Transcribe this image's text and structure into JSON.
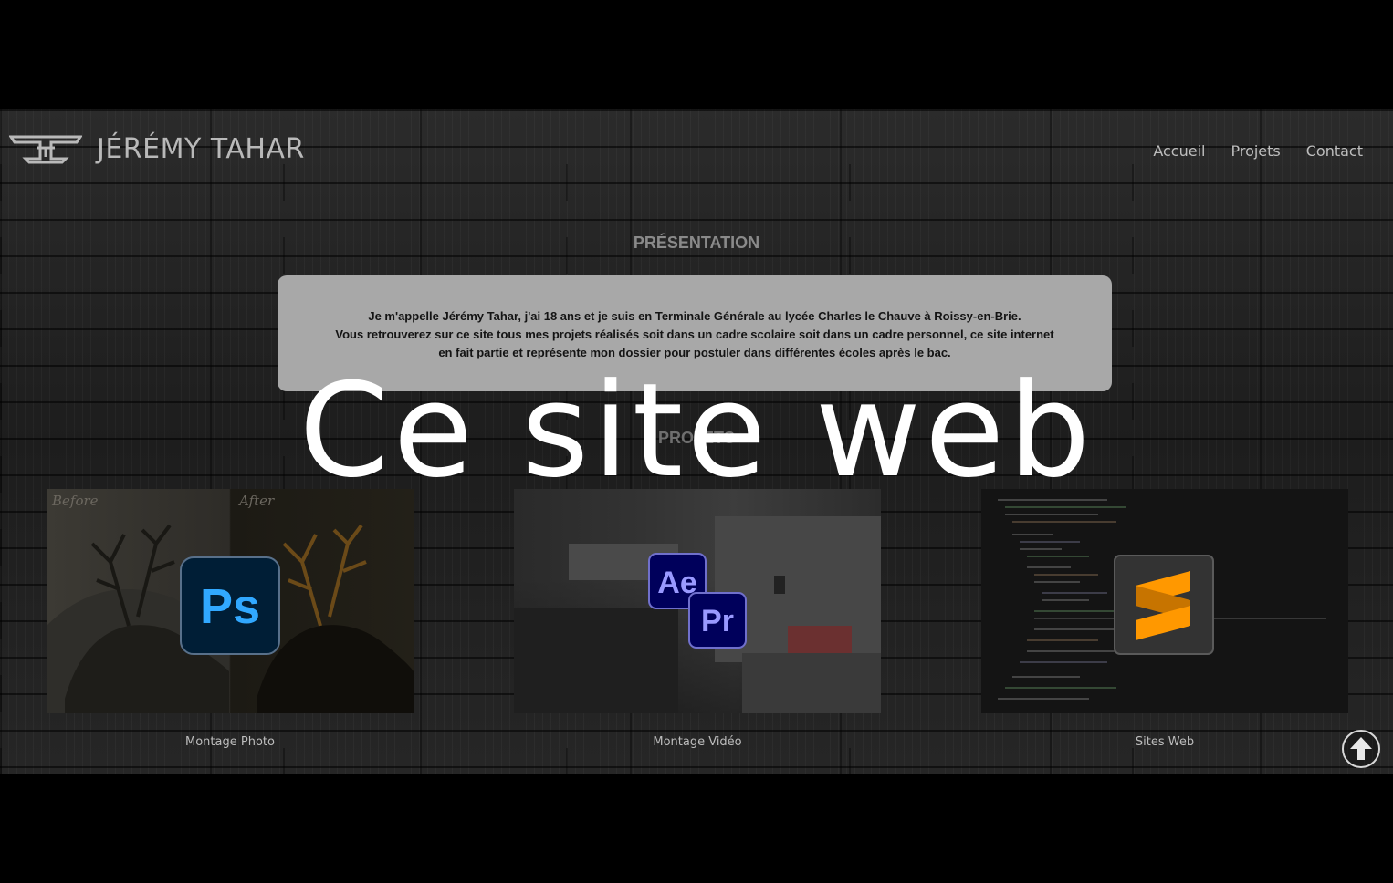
{
  "brand": {
    "name": "JÉRÉMY TAHAR",
    "logo_icon": "jt-monogram-icon"
  },
  "nav": {
    "items": [
      "Accueil",
      "Projets",
      "Contact"
    ]
  },
  "presentation": {
    "title": "PRÉSENTATION",
    "lines": [
      "Je m'appelle Jérémy Tahar, j'ai 18 ans et je suis en Terminale Générale au lycée Charles le Chauve à Roissy-en-Brie.",
      "Vous retrouverez sur ce site tous mes projets réalisés soit dans un cadre scolaire soit dans un cadre personnel, ce site internet",
      "en fait partie et représente mon dossier pour postuler dans différentes écoles après le bac."
    ]
  },
  "projects": {
    "title": "PROJETS",
    "items": [
      {
        "label": "Montage Photo",
        "icon": "photoshop-icon",
        "thumb_text": [
          "Before",
          "After"
        ],
        "icon_text": [
          "Ps"
        ]
      },
      {
        "label": "Montage Vidéo",
        "icon": "after-effects-premiere-icon",
        "icon_text": [
          "Ae",
          "Pr"
        ]
      },
      {
        "label": "Sites Web",
        "icon": "sublime-text-icon"
      }
    ]
  },
  "overlay": {
    "text": "Ce site web"
  },
  "scroll_top": {
    "icon": "arrow-up-icon"
  },
  "colors": {
    "page_background": "#000000",
    "presentation_box": "#a8a8a8",
    "photoshop_bg": "#001e36",
    "photoshop_text": "#31a8ff",
    "after_effects_bg": "#00005b",
    "after_effects_text": "#9999ff",
    "premiere_bg": "#00005b",
    "premiere_text": "#9999ff",
    "sublime_bg": "#333333",
    "sublime_accent": "#ff9800"
  }
}
